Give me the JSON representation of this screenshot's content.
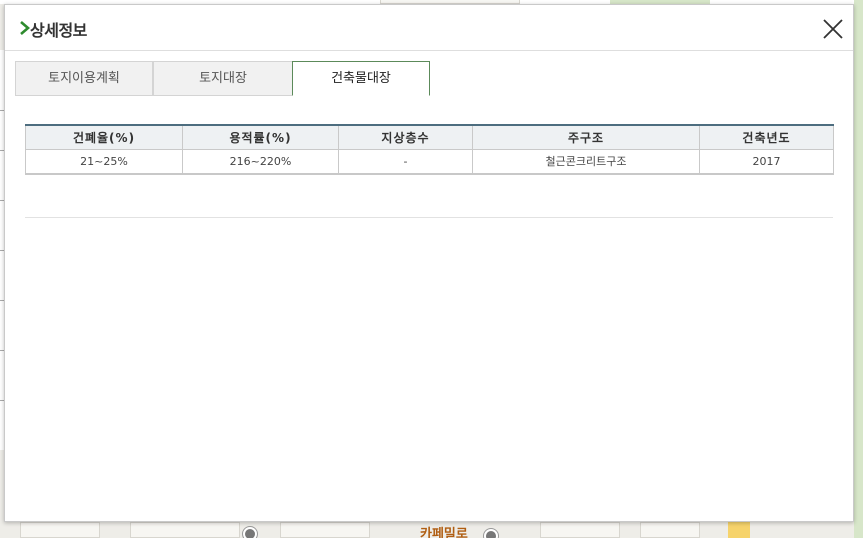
{
  "modal": {
    "title": "상세정보"
  },
  "tabs": [
    {
      "label": "토지이용계획",
      "active": false
    },
    {
      "label": "토지대장",
      "active": false
    },
    {
      "label": "건축물대장",
      "active": true
    }
  ],
  "building_table": {
    "headers": [
      "건폐율(%)",
      "용적률(%)",
      "지상층수",
      "주구조",
      "건축년도"
    ],
    "rows": [
      [
        "21~25%",
        "216~220%",
        "-",
        "철근콘크리트구조",
        "2017"
      ]
    ]
  },
  "map": {
    "road_label": "카페밀로"
  },
  "colors": {
    "accent_green": "#2e8b2e",
    "table_header_top": "#4d6d7f"
  }
}
